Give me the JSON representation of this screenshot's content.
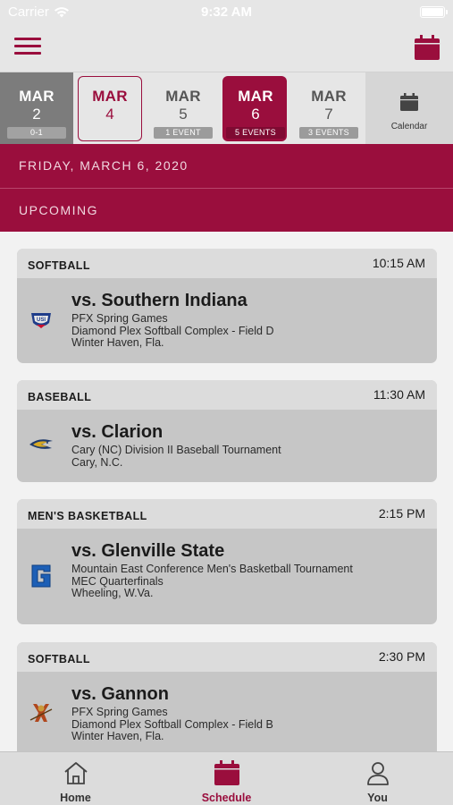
{
  "status_bar": {
    "carrier": "Carrier",
    "time": "9:32 AM"
  },
  "colors": {
    "brand": "#9a0e3d",
    "header_bg": "#e6e6e6",
    "card_bg": "#c6c6c6"
  },
  "header": {
    "menu_icon": "hamburger-icon",
    "calendar_icon": "calendar-icon"
  },
  "date_strip": {
    "days": [
      {
        "month": "MAR",
        "day": "2",
        "badge": "0-1",
        "state": "past"
      },
      {
        "month": "MAR",
        "day": "4",
        "badge": "",
        "state": "today"
      },
      {
        "month": "MAR",
        "day": "5",
        "badge": "1 EVENT",
        "state": "normal"
      },
      {
        "month": "MAR",
        "day": "6",
        "badge": "5 EVENTS",
        "state": "selected"
      },
      {
        "month": "MAR",
        "day": "7",
        "badge": "3 EVENTS",
        "state": "normal"
      }
    ],
    "calendar_label": "Calendar"
  },
  "selected_date": "FRIDAY, MARCH 6, 2020",
  "section_label": "UPCOMING",
  "events": [
    {
      "sport": "SOFTBALL",
      "time": "10:15 AM",
      "opponent": "vs. Southern Indiana",
      "lines": [
        "PFX Spring Games",
        "Diamond Plex Softball Complex - Field D",
        "Winter Haven, Fla."
      ],
      "logo": "usi-logo"
    },
    {
      "sport": "BASEBALL",
      "time": "11:30 AM",
      "opponent": "vs. Clarion",
      "lines": [
        "Cary (NC) Division II Baseball Tournament",
        "Cary, N.C."
      ],
      "logo": "clarion-eagle-logo"
    },
    {
      "sport": "MEN'S BASKETBALL",
      "time": "2:15 PM",
      "opponent": "vs. Glenville State",
      "lines": [
        "Mountain East Conference Men's Basketball Tournament",
        "MEC Quarterfinals",
        "Wheeling, W.Va."
      ],
      "logo": "glenville-g-logo"
    },
    {
      "sport": "SOFTBALL",
      "time": "2:30 PM",
      "opponent": "vs. Gannon",
      "lines": [
        "PFX Spring Games",
        "Diamond Plex Softball Complex - Field B",
        "Winter Haven, Fla."
      ],
      "logo": "gannon-knight-logo"
    }
  ],
  "tab_bar": [
    {
      "label": "Home",
      "icon": "home-icon"
    },
    {
      "label": "Schedule",
      "icon": "calendar-icon",
      "active": true
    },
    {
      "label": "You",
      "icon": "person-icon"
    }
  ]
}
